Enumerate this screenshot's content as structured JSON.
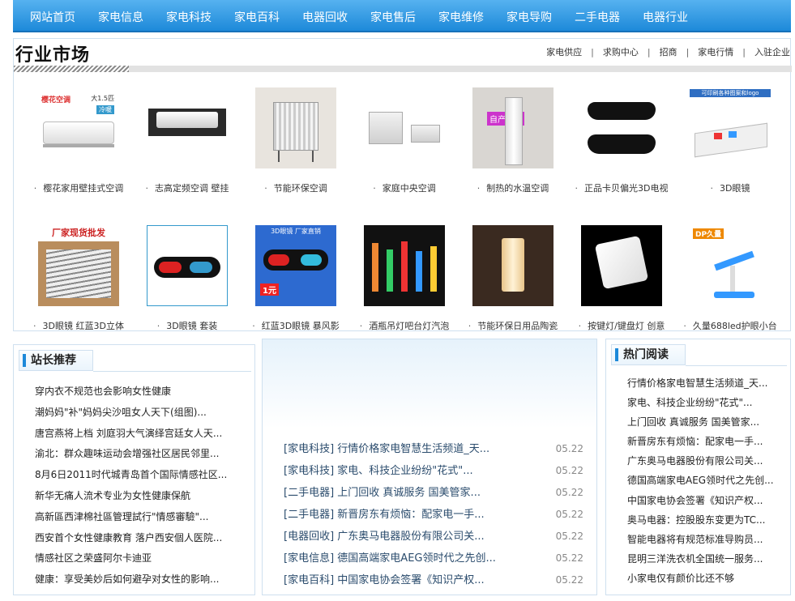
{
  "nav": {
    "items": [
      "网站首页",
      "家电信息",
      "家电科技",
      "家电百科",
      "电器回收",
      "家电售后",
      "家电维修",
      "家电导购",
      "二手电器",
      "电器行业"
    ]
  },
  "market": {
    "title": "行业市场",
    "links": [
      "家电供应",
      "求购中心",
      "招商",
      "家电行情",
      "入驻企业"
    ],
    "products": [
      {
        "caption": "樱花家用壁挂式空调",
        "thumb_text": "樱花空调",
        "thumb_sub": "大1.5匹",
        "thumb_badge": "冷暖"
      },
      {
        "caption": "志高定频空调 壁挂"
      },
      {
        "caption": "节能环保空调"
      },
      {
        "caption": "家庭中央空调"
      },
      {
        "caption": "制热的水温空调",
        "thumb_text": "自产自销"
      },
      {
        "caption": "正品卡贝偏光3D电视"
      },
      {
        "caption": "3D眼镜",
        "thumb_text": "可印刷各种图案和logo"
      },
      {
        "caption": "3D眼镜 红蓝3D立体",
        "thumb_text": "厂家现货批发"
      },
      {
        "caption": "3D眼镜 套装"
      },
      {
        "caption": "红蓝3D眼镜 暴风影",
        "thumb_text": "3D眼镜 厂家直销",
        "thumb_price": "1元"
      },
      {
        "caption": "酒瓶吊灯吧台灯汽泡"
      },
      {
        "caption": "节能环保日用品陶瓷"
      },
      {
        "caption": "按键灯/键盘灯 创意"
      },
      {
        "caption": "久量688led护眼小台",
        "thumb_text": "DP久量"
      }
    ]
  },
  "left_panel": {
    "title": "站长推荐",
    "items": [
      "穿内衣不规范也会影响女性健康",
      "潮妈妈\"补\"妈妈尖沙咀女人天下(组图)...",
      "唐宫燕将上档 刘庭羽大气演绎宫廷女人天...",
      "渝北：群众趣味运动会增强社区居民邻里...",
      "8月6日2011时代城青岛首个国际情感社区...",
      "新华无痛人流术专业为女性健康保航",
      "高新區西津棉社區管理試行\"情感審驗\"...",
      "西安首个女性健康教育 落户西安個人医院...",
      "情感社区之荣盛阿尔卡迪亚",
      "健康：享受美妙后如何避孕对女性的影响..."
    ]
  },
  "mid_panel": {
    "news": [
      {
        "category": "[家电科技]",
        "title": "行情价格家电智慧生活频道_天...",
        "date": "05.22"
      },
      {
        "category": "[家电科技]",
        "title": "家电、科技企业纷纷\"花式\"...",
        "date": "05.22"
      },
      {
        "category": "[二手电器]",
        "title": "上门回收 真诚服务 国美管家...",
        "date": "05.22"
      },
      {
        "category": "[二手电器]",
        "title": "新晋房东有烦恼：配家电一手...",
        "date": "05.22"
      },
      {
        "category": "[电器回收]",
        "title": "广东奥马电器股份有限公司关...",
        "date": "05.22"
      },
      {
        "category": "[家电信息]",
        "title": "德国高端家电AEG领时代之先创...",
        "date": "05.22"
      },
      {
        "category": "[家电百科]",
        "title": "中国家电协会签署《知识产权...",
        "date": "05.22"
      }
    ]
  },
  "right_panel": {
    "title": "热门阅读",
    "items": [
      "行情价格家电智慧生活频道_天...",
      "家电、科技企业纷纷\"花式\"...",
      "上门回收 真诚服务 国美管家...",
      "新晋房东有烦恼：配家电一手...",
      "广东奥马电器股份有限公司关...",
      "德国高端家电AEG领时代之先创...",
      "中国家电协会签署《知识产权...",
      "奥马电器：控股股东变更为TC...",
      "智能电器将有规范标准导购员...",
      "昆明三洋洗衣机全国统一服务...",
      "小家电仅有颜价比还不够"
    ]
  },
  "colors": {
    "nav_top": "#56b2f0",
    "nav_bottom": "#1d89d9",
    "accent": "#1d89d9",
    "border": "#cfe0ef"
  }
}
